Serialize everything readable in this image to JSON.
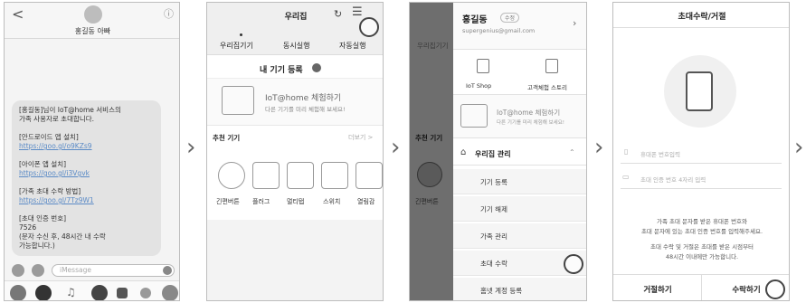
{
  "phone1": {
    "back_glyph": "<",
    "info_glyph": "ⓘ",
    "contact_name": "홍길동 아빠",
    "message_lines": [
      {
        "text": "[홍길동]님이 IoT@home 서비스의",
        "link": false
      },
      {
        "text": "가족 사용자로 초대합니다.",
        "link": false
      },
      {
        "text": "",
        "link": false
      },
      {
        "text": "[안드로이드 앱 설치]",
        "link": false
      },
      {
        "text": "https://goo.gl/o9KZs9",
        "link": true
      },
      {
        "text": "",
        "link": false
      },
      {
        "text": "[아이폰 앱 설치]",
        "link": false
      },
      {
        "text": "https://goo.gl/i3Vgvk",
        "link": true
      },
      {
        "text": "",
        "link": false
      },
      {
        "text": "[가족 초대 수락 방법]",
        "link": false
      },
      {
        "text": "https://goo.gl/7Tz9W1",
        "link": true
      },
      {
        "text": "",
        "link": false
      },
      {
        "text": "[초대 인증 번호]",
        "link": false
      },
      {
        "text": "7526",
        "link": false
      },
      {
        "text": "(문자 수신 후, 48시간 내 수락",
        "link": false
      },
      {
        "text": "가능합니다.)",
        "link": false
      }
    ],
    "input_placeholder": "iMessage"
  },
  "phone2": {
    "title": "우리집",
    "tabs": [
      "우리집기기",
      "동시실행",
      "자동실행"
    ],
    "register_label": "내 기기 등록",
    "banner_title": "IoT@home 체험하기",
    "banner_sub": "다른 기기를 미리 체험해 보세요!",
    "recommend_label": "추천 기기",
    "more_label": "더보기 >",
    "devices": [
      "긴편버튼",
      "플러그",
      "멀티탭",
      "스위치",
      "열림감"
    ]
  },
  "phone3": {
    "user_name": "홍길동",
    "user_badge": "수정",
    "user_email": "supergenius@gmail.com",
    "shop_label": "IoT Shop",
    "story_label": "고객체험 스토리",
    "banner_title": "IoT@home 체험하기",
    "banner_sub": "다른 기기를 미리 체험해 보세요!",
    "section_label": "우리집 관리",
    "menu": [
      "기기 등록",
      "기기 해제",
      "가족 관리",
      "초대 수락",
      "홈넷 계정 등록"
    ],
    "bg_tab": "우리집기기",
    "bg_recommend": "추천 기기",
    "bg_device": "긴편버튼"
  },
  "phone4": {
    "title": "초대수락/거절",
    "phone_placeholder": "휴대폰 번호입력",
    "code_placeholder": "초대 인증 번호 4자리 입력",
    "info_line1": "가족 초대 문자를 받은 휴대폰 번호와",
    "info_line2": "초대 문자에 있는 초대 인증 번호를 입력해주세요.",
    "info_line3": "초대 수락 및 거절은 초대를 받은 시점부터",
    "info_line4": "48시간 이내에만 가능합니다.",
    "reject_label": "거절하기",
    "accept_label": "수락하기"
  },
  "arrow_glyph": "›"
}
